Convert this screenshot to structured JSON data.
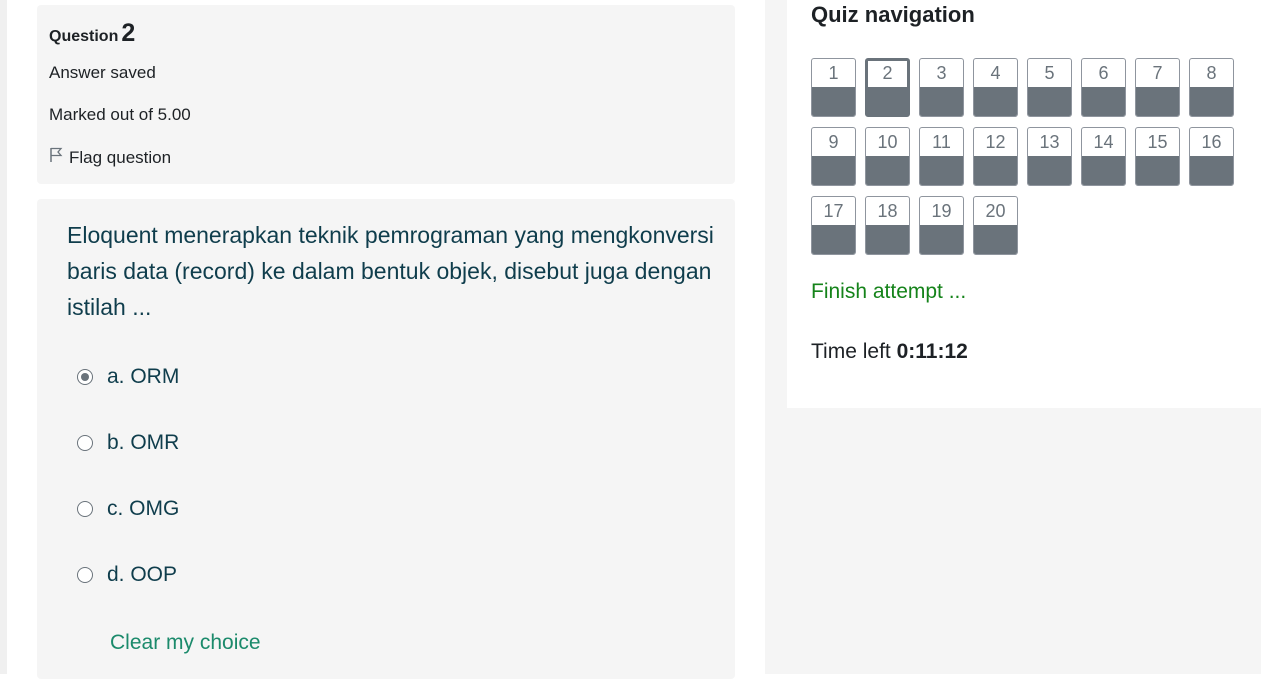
{
  "question_info": {
    "label": "Question",
    "number": "2",
    "status": "Answer saved",
    "marks": "Marked out of 5.00",
    "flag_label": "Flag question"
  },
  "question": {
    "text": "Eloquent menerapkan teknik pemrograman yang mengkonversi baris data (record) ke dalam bentuk objek, disebut juga dengan istilah ...",
    "options": [
      {
        "label": "a. ORM",
        "selected": true
      },
      {
        "label": "b. OMR",
        "selected": false
      },
      {
        "label": "c. OMG",
        "selected": false
      },
      {
        "label": "d. OOP",
        "selected": false
      }
    ],
    "clear_label": "Clear my choice"
  },
  "quiz_nav": {
    "title": "Quiz navigation",
    "buttons": [
      "1",
      "2",
      "3",
      "4",
      "5",
      "6",
      "7",
      "8",
      "9",
      "10",
      "11",
      "12",
      "13",
      "14",
      "15",
      "16",
      "17",
      "18",
      "19",
      "20"
    ],
    "current": "2",
    "finish_label": "Finish attempt ...",
    "time_label": "Time left",
    "time_value": "0:11:12"
  },
  "colors": {
    "text_primary": "#0f3d4c",
    "answered": "#6a737b",
    "finish": "#15831a",
    "clear": "#1b8a6b"
  }
}
